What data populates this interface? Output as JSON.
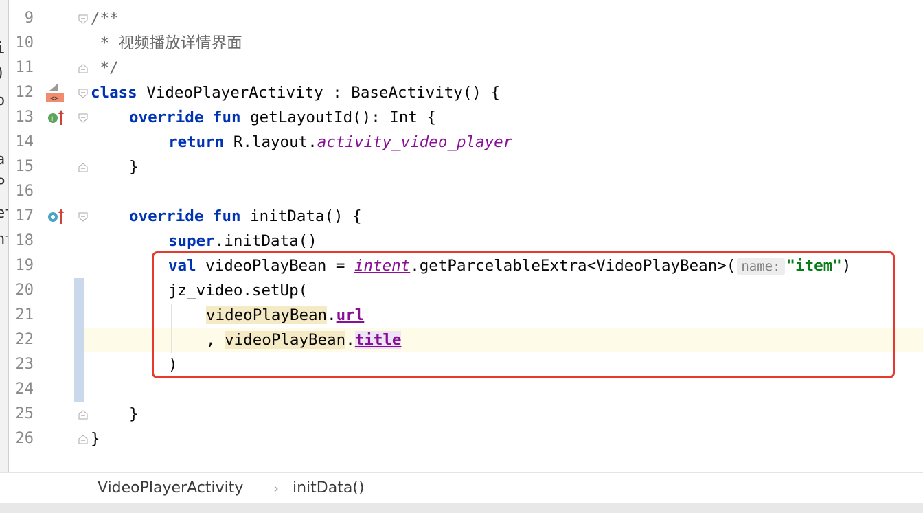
{
  "editor": {
    "line_numbers": [
      "9",
      "10",
      "11",
      "12",
      "13",
      "14",
      "15",
      "16",
      "17",
      "18",
      "19",
      "20",
      "21",
      "22",
      "23",
      "24",
      "25",
      "26"
    ],
    "lines": {
      "l9": "/**",
      "l10": " * 视频播放详情界面",
      "l11": " */",
      "l12_kw": "class",
      "l12_rest": " VideoPlayerActivity : BaseActivity() {",
      "l13_kw1": "override",
      "l13_kw2": "fun",
      "l13_rest": " getLayoutId(): Int {",
      "l14_kw": "return",
      "l14_mid": " R.layout.",
      "l14_res": "activity_video_player",
      "l15": "}",
      "l17_kw1": "override",
      "l17_kw2": "fun",
      "l17_rest": " initData() {",
      "l18_kw": "super",
      "l18_rest": ".initData()",
      "l19_kw": "val",
      "l19_mid": " videoPlayBean = ",
      "l19_intent": "intent",
      "l19_call": ".getParcelableExtra<VideoPlayBean>(",
      "l19_hint": "name:",
      "l19_str": "\"item\"",
      "l19_end": ")",
      "l20": "jz_video.setUp(",
      "l21_var": "videoPlayBean",
      "l21_dot": ".",
      "l21_prop": "url",
      "l22_comma": ", ",
      "l22_var": "videoPlayBean",
      "l22_dot": ".",
      "l22_prop": "title",
      "l23": ")",
      "l25": "}",
      "l26": "}"
    }
  },
  "breadcrumb": {
    "class_name": "VideoPlayerActivity",
    "separator": "›",
    "method_name": "initData()"
  },
  "left_strip_chars": [
    "ir",
    ")",
    "o",
    "a",
    "P",
    "et",
    "nt"
  ],
  "gutter_icons": {
    "line12": "class-implementation-icon",
    "line13": "implements-method-icon",
    "line17": "overrides-method-icon"
  },
  "colors": {
    "keyword": "#0033b3",
    "string": "#067d17",
    "property": "#871094",
    "highlight_box": "#e8392f",
    "current_line": "#fefbe8"
  }
}
